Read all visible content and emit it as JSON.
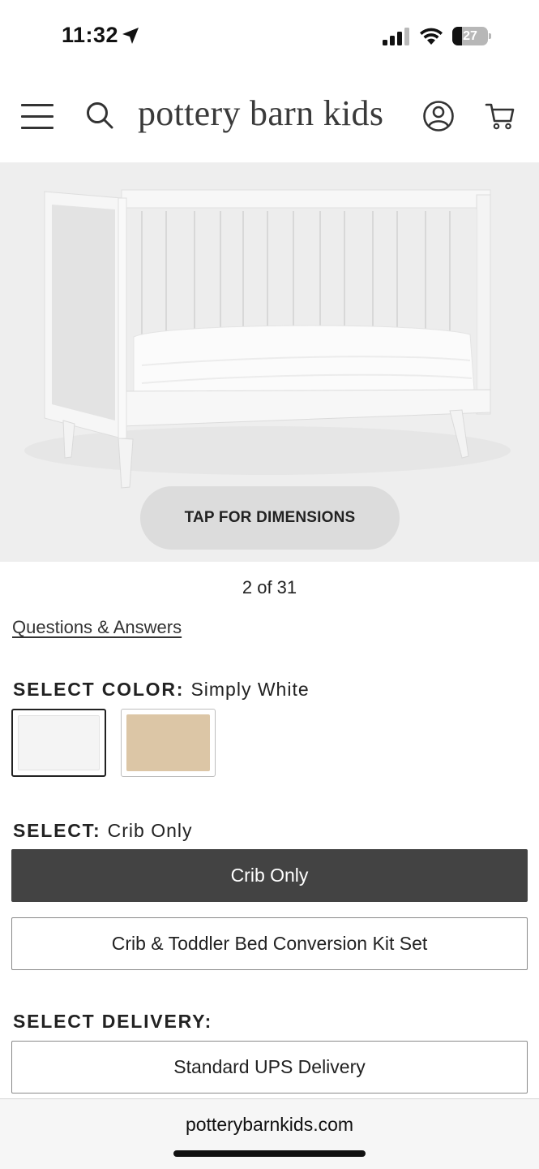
{
  "status_bar": {
    "time": "11:32",
    "battery_level": "27",
    "battery_fraction": 0.27,
    "icons": [
      "location-arrow-icon",
      "cellular-signal-icon",
      "wifi-icon",
      "battery-icon"
    ]
  },
  "header": {
    "brand": "pottery barn kids",
    "icons": [
      "menu-icon",
      "search-icon",
      "account-icon",
      "cart-icon"
    ]
  },
  "gallery": {
    "dimensions_button": "TAP FOR DIMENSIONS",
    "counter": "2 of 31"
  },
  "qa_link": "Questions & Answers",
  "color_section": {
    "label": "SELECT COLOR:",
    "selected_value": "Simply White",
    "swatches": [
      {
        "name": "Simply White",
        "color": "#f4f4f4",
        "selected": true
      },
      {
        "name": "natural",
        "color": "#dcc6a6",
        "selected": false
      }
    ]
  },
  "config_section": {
    "label": "SELECT:",
    "selected_value": "Crib Only",
    "options": [
      {
        "label": "Crib Only",
        "selected": true
      },
      {
        "label": "Crib & Toddler Bed Conversion Kit Set",
        "selected": false
      }
    ]
  },
  "delivery_section": {
    "label": "SELECT DELIVERY:",
    "options": [
      {
        "label": "Standard UPS Delivery",
        "selected": false
      }
    ]
  },
  "browser": {
    "url": "potterybarnkids.com"
  },
  "colors": {
    "selected_button_bg": "#434343",
    "image_bg": "#eeeeee",
    "dimensions_button_bg": "#dcdcdc"
  }
}
